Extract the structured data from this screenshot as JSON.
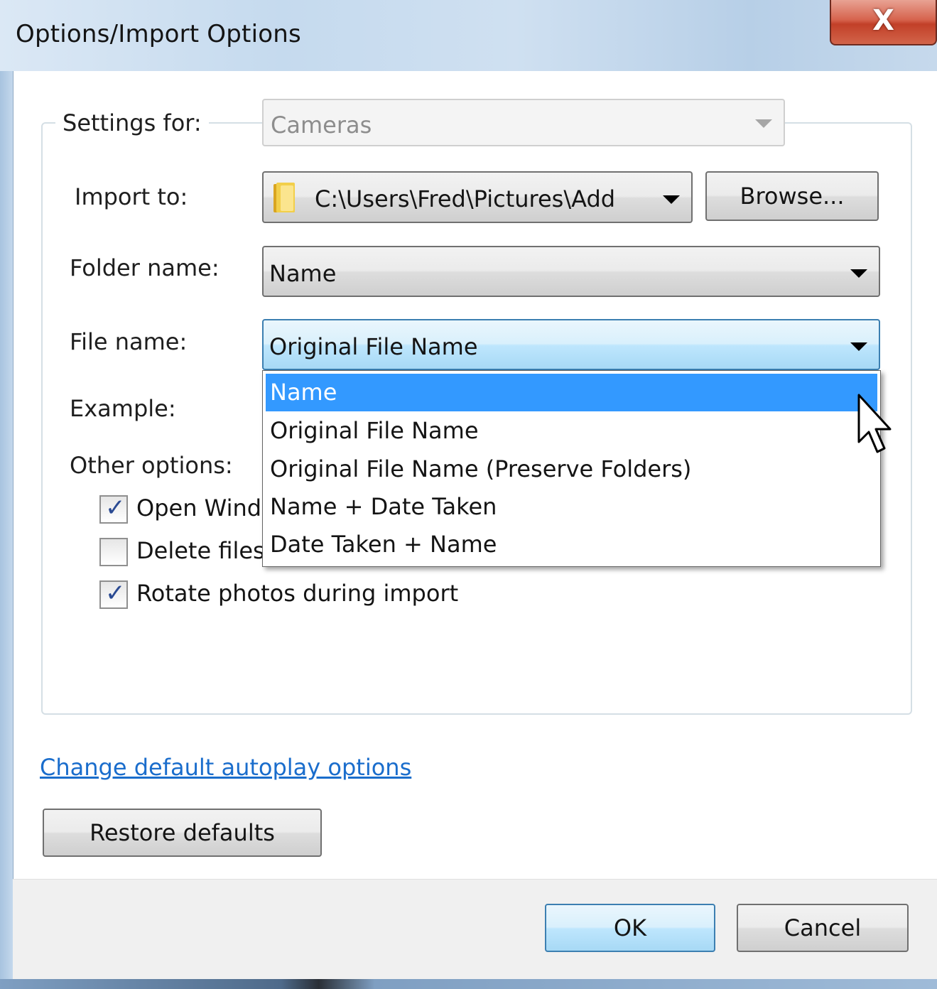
{
  "window": {
    "title": "Options/Import Options",
    "close_label": "X"
  },
  "settings_for": {
    "label": "Settings for:",
    "value": "Cameras"
  },
  "import_to": {
    "label": "Import to:",
    "value": "C:\\Users\\Fred\\Pictures\\Add",
    "browse_label": "Browse..."
  },
  "folder_name": {
    "label": "Folder name:",
    "value": "Name"
  },
  "file_name": {
    "label": "File name:",
    "value": "Original File Name",
    "options": [
      "Name",
      "Original File Name",
      "Original File Name (Preserve Folders)",
      "Name + Date Taken",
      "Date Taken + Name"
    ],
    "highlighted_index": 0
  },
  "example": {
    "label": "Example:"
  },
  "other_options": {
    "label": "Other options:",
    "items": [
      {
        "label": "Open Wind",
        "checked": true
      },
      {
        "label": "Delete files",
        "checked": false
      },
      {
        "label": "Rotate photos during import",
        "checked": true
      }
    ]
  },
  "links": {
    "autoplay": "Change default autoplay options"
  },
  "buttons": {
    "restore": "Restore defaults",
    "ok": "OK",
    "cancel": "Cancel"
  },
  "icons": {
    "folder": "folder-icon",
    "cursor": "mouse-pointer-icon",
    "check": "checkmark-icon"
  },
  "colors": {
    "selection": "#3399ff",
    "link": "#1a6dcc",
    "close_button": "#c24028"
  }
}
